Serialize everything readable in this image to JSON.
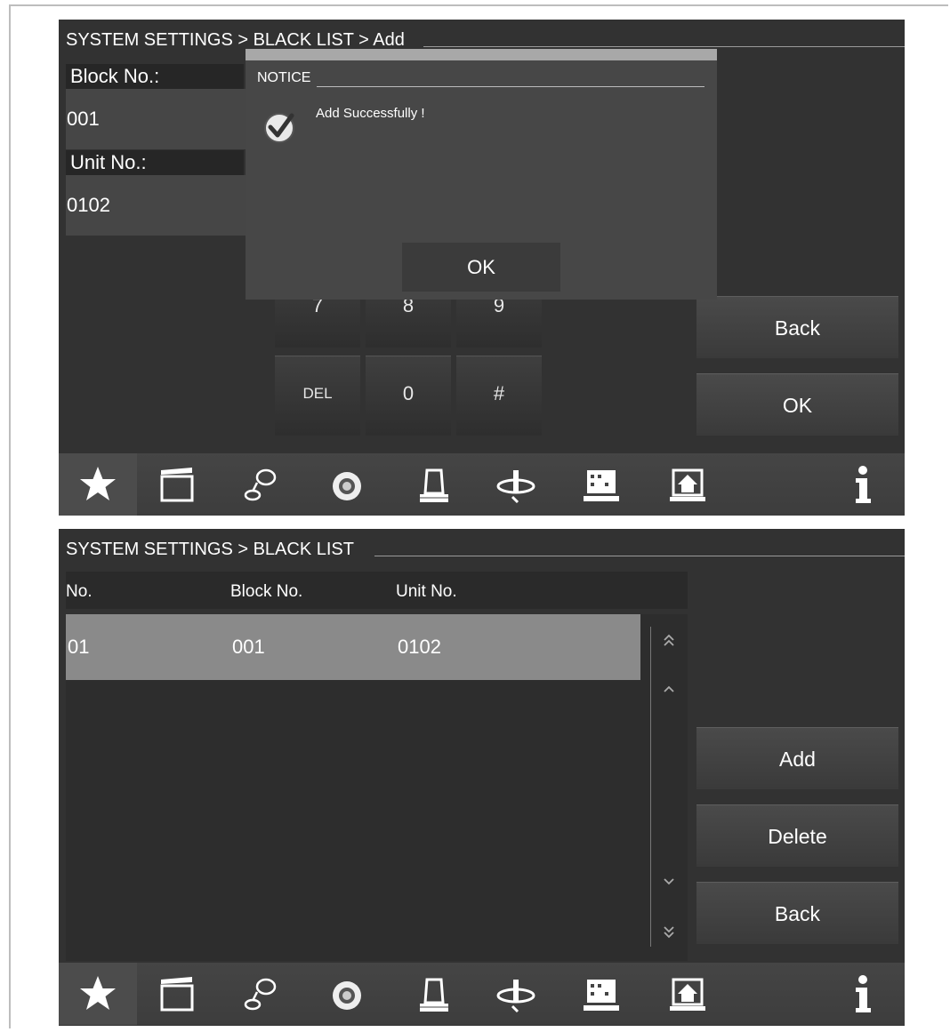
{
  "screen1": {
    "breadcrumb": "SYSTEM SETTINGS > BLACK LIST > Add",
    "block_label": "Block No.:",
    "block_value": "001",
    "unit_label": "Unit No.:",
    "unit_value": "0102",
    "keypad": {
      "partial_keys": [
        "7",
        "8",
        "9"
      ],
      "keys": [
        "DEL",
        "0",
        "#"
      ]
    },
    "right_buttons": {
      "back": "Back",
      "ok": "OK"
    },
    "dialog": {
      "title": "NOTICE",
      "message": "Add Successfully !",
      "ok_label": "OK",
      "icon": "check-icon"
    }
  },
  "screen2": {
    "breadcrumb": "SYSTEM SETTINGS > BLACK LIST",
    "columns": [
      "No.",
      "Block No.",
      "Unit No."
    ],
    "rows": [
      {
        "no": "01",
        "block": "001",
        "unit": "0102"
      }
    ],
    "right_buttons": {
      "add": "Add",
      "delete": "Delete",
      "back": "Back"
    },
    "scroll_icons": [
      "double-up-icon",
      "up-icon",
      "down-icon",
      "double-down-icon"
    ]
  },
  "taskbar": {
    "icons": [
      "star-icon",
      "clapper-icon",
      "intercom-icon",
      "camera-icon",
      "alarm-icon",
      "lift-icon",
      "building-icon",
      "home-icon",
      "info-icon"
    ]
  },
  "colors": {
    "screen_bg": "#323232",
    "selected_row": "#8a8a8a",
    "dialog_bg": "#474747"
  }
}
